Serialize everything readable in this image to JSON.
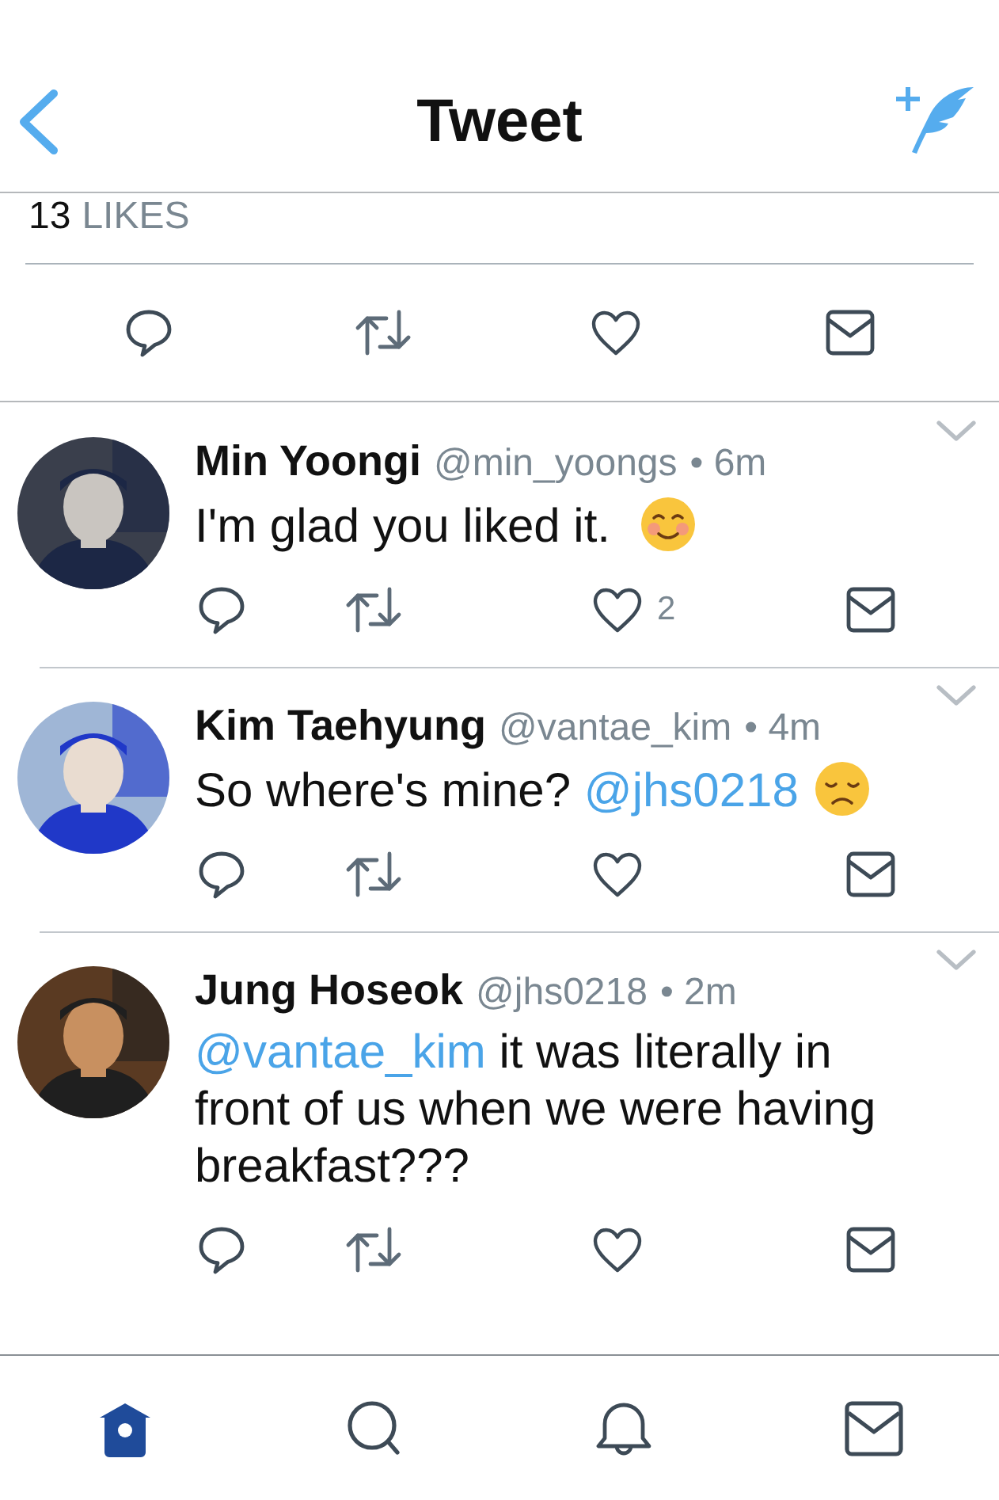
{
  "header": {
    "title": "Tweet"
  },
  "likes": {
    "count": "13",
    "label": "LIKES"
  },
  "tweets": [
    {
      "name": "Min Yoongi",
      "handle": "@min_yoongs",
      "time": "• 6m",
      "avatar": {
        "kind": "picture"
      },
      "body": [
        {
          "kind": "text",
          "text": "I'm glad you liked it. "
        },
        {
          "kind": "smiling-emoji"
        }
      ],
      "like_count": "2"
    },
    {
      "name": "Kim Taehyung",
      "handle": "@vantae_kim",
      "time": "• 4m",
      "avatar": {
        "kind": "picture"
      },
      "body": [
        {
          "kind": "text",
          "text": "So where's mine? "
        },
        {
          "kind": "mention",
          "text": "@jhs0218"
        },
        {
          "kind": "sad-emoji"
        }
      ]
    },
    {
      "name": "Jung Hoseok",
      "handle": "@jhs0218",
      "time": "• 2m",
      "avatar": {
        "kind": "picture"
      },
      "body": [
        {
          "kind": "mention",
          "text": "@vantae_kim"
        },
        {
          "kind": "text",
          "text": " it was literally in front of us when we were having breakfast???"
        }
      ]
    }
  ],
  "tabs": [
    {
      "kind": "home",
      "selected": true
    },
    {
      "kind": "search",
      "selected": false
    },
    {
      "kind": "notifications",
      "selected": false
    },
    {
      "kind": "messages",
      "selected": false
    }
  ]
}
